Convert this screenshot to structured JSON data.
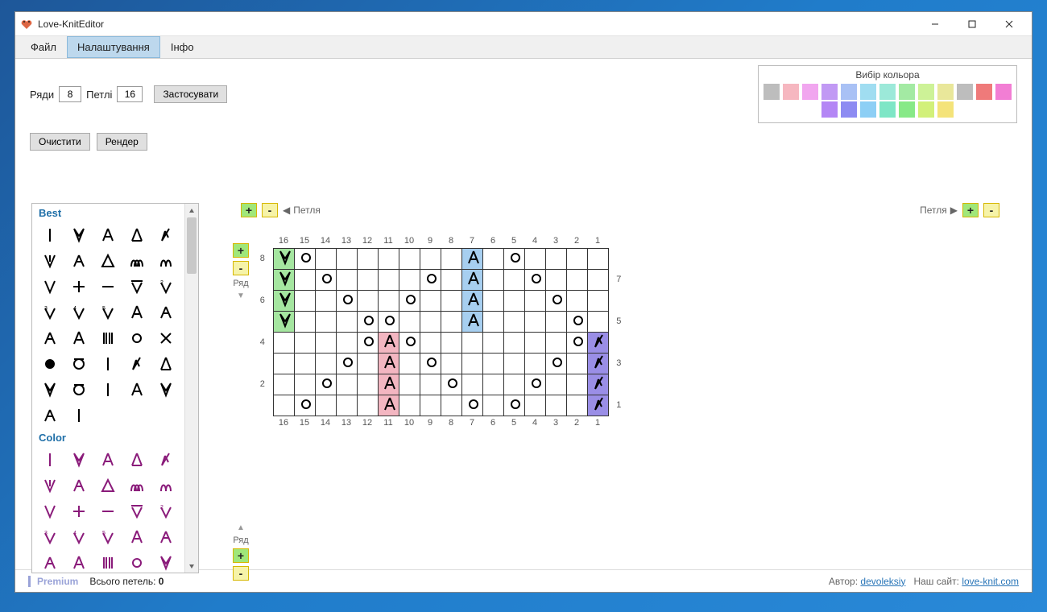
{
  "window": {
    "title": "Love-KnitEditor"
  },
  "menu": {
    "file": "Файл",
    "settings": "Налаштування",
    "info": "Інфо"
  },
  "toolbar": {
    "rows_label": "Ряди",
    "rows_value": "8",
    "stitches_label": "Петлі",
    "stitches_value": "16",
    "apply": "Застосувати",
    "clear": "Очистити",
    "render": "Рендер"
  },
  "color_picker": {
    "label": "Вибір кольора",
    "row1": [
      "#bdbdbd",
      "#f6b7c0",
      "#f1a6ef",
      "#c199f4",
      "#a9c1f5",
      "#a0ddf1",
      "#9ce9d9",
      "#a3eaa3",
      "#cdf297",
      "#e9e79a",
      "#bdbdbd",
      "#ef7a7a",
      "#f27ed4"
    ],
    "row2": [
      "#b486f5",
      "#8d8bf2",
      "#8dcff5",
      "#7ee6c6",
      "#87e987",
      "#d2f07a",
      "#f4e37a"
    ]
  },
  "palette": {
    "best": "Best",
    "color": "Color"
  },
  "canvas": {
    "stitch_label": "Петля",
    "row_label": "Ряд",
    "plus": "+",
    "minus": "-",
    "cols": [
      16,
      15,
      14,
      13,
      12,
      11,
      10,
      9,
      8,
      7,
      6,
      5,
      4,
      3,
      2,
      1
    ],
    "rows_left": [
      8,
      "",
      6,
      "",
      4,
      "",
      2,
      ""
    ],
    "rows_right": [
      "",
      7,
      "",
      5,
      "",
      3,
      "",
      1
    ],
    "grid": [
      [
        {
          "s": "dr",
          "bg": "green"
        },
        {
          "s": "o"
        },
        {},
        {},
        {},
        {},
        {},
        {},
        {},
        {
          "s": "ud",
          "bg": "blue"
        },
        {},
        {
          "s": "o"
        },
        {},
        {},
        {},
        {}
      ],
      [
        {
          "s": "dr",
          "bg": "green"
        },
        {},
        {
          "s": "o"
        },
        {},
        {},
        {},
        {},
        {
          "s": "o"
        },
        {},
        {
          "s": "ud",
          "bg": "blue"
        },
        {},
        {},
        {
          "s": "o"
        },
        {},
        {},
        {}
      ],
      [
        {
          "s": "dr",
          "bg": "green"
        },
        {},
        {},
        {
          "s": "o"
        },
        {},
        {},
        {
          "s": "o"
        },
        {},
        {},
        {
          "s": "ud",
          "bg": "blue"
        },
        {},
        {},
        {},
        {
          "s": "o"
        },
        {},
        {}
      ],
      [
        {
          "s": "dr",
          "bg": "green"
        },
        {},
        {},
        {},
        {
          "s": "o"
        },
        {
          "s": "o"
        },
        {},
        {},
        {},
        {
          "s": "ud",
          "bg": "blue"
        },
        {},
        {},
        {},
        {},
        {
          "s": "o"
        },
        {}
      ],
      [
        {},
        {},
        {},
        {},
        {
          "s": "o"
        },
        {
          "s": "ud",
          "bg": "pink"
        },
        {
          "s": "o"
        },
        {},
        {},
        {},
        {},
        {},
        {},
        {},
        {
          "s": "o"
        },
        {
          "s": "dl",
          "bg": "violet"
        }
      ],
      [
        {},
        {},
        {},
        {
          "s": "o"
        },
        {},
        {
          "s": "ud",
          "bg": "pink"
        },
        {},
        {
          "s": "o"
        },
        {},
        {},
        {},
        {},
        {},
        {
          "s": "o"
        },
        {},
        {
          "s": "dl",
          "bg": "violet"
        }
      ],
      [
        {},
        {},
        {
          "s": "o"
        },
        {},
        {},
        {
          "s": "ud",
          "bg": "pink"
        },
        {},
        {},
        {
          "s": "o"
        },
        {},
        {},
        {},
        {
          "s": "o"
        },
        {},
        {},
        {
          "s": "dl",
          "bg": "violet"
        }
      ],
      [
        {},
        {
          "s": "o"
        },
        {},
        {},
        {},
        {
          "s": "ud",
          "bg": "pink"
        },
        {},
        {},
        {},
        {
          "s": "o"
        },
        {},
        {
          "s": "o"
        },
        {},
        {},
        {},
        {
          "s": "dl",
          "bg": "violet"
        }
      ]
    ]
  },
  "status": {
    "premium": "Premium",
    "total_label": "Всього петель:",
    "total_value": "0",
    "author_label": "Автор:",
    "author_link": "devoleksiy",
    "site_label": "Наш сайт:",
    "site_link": "love-knit.com"
  }
}
